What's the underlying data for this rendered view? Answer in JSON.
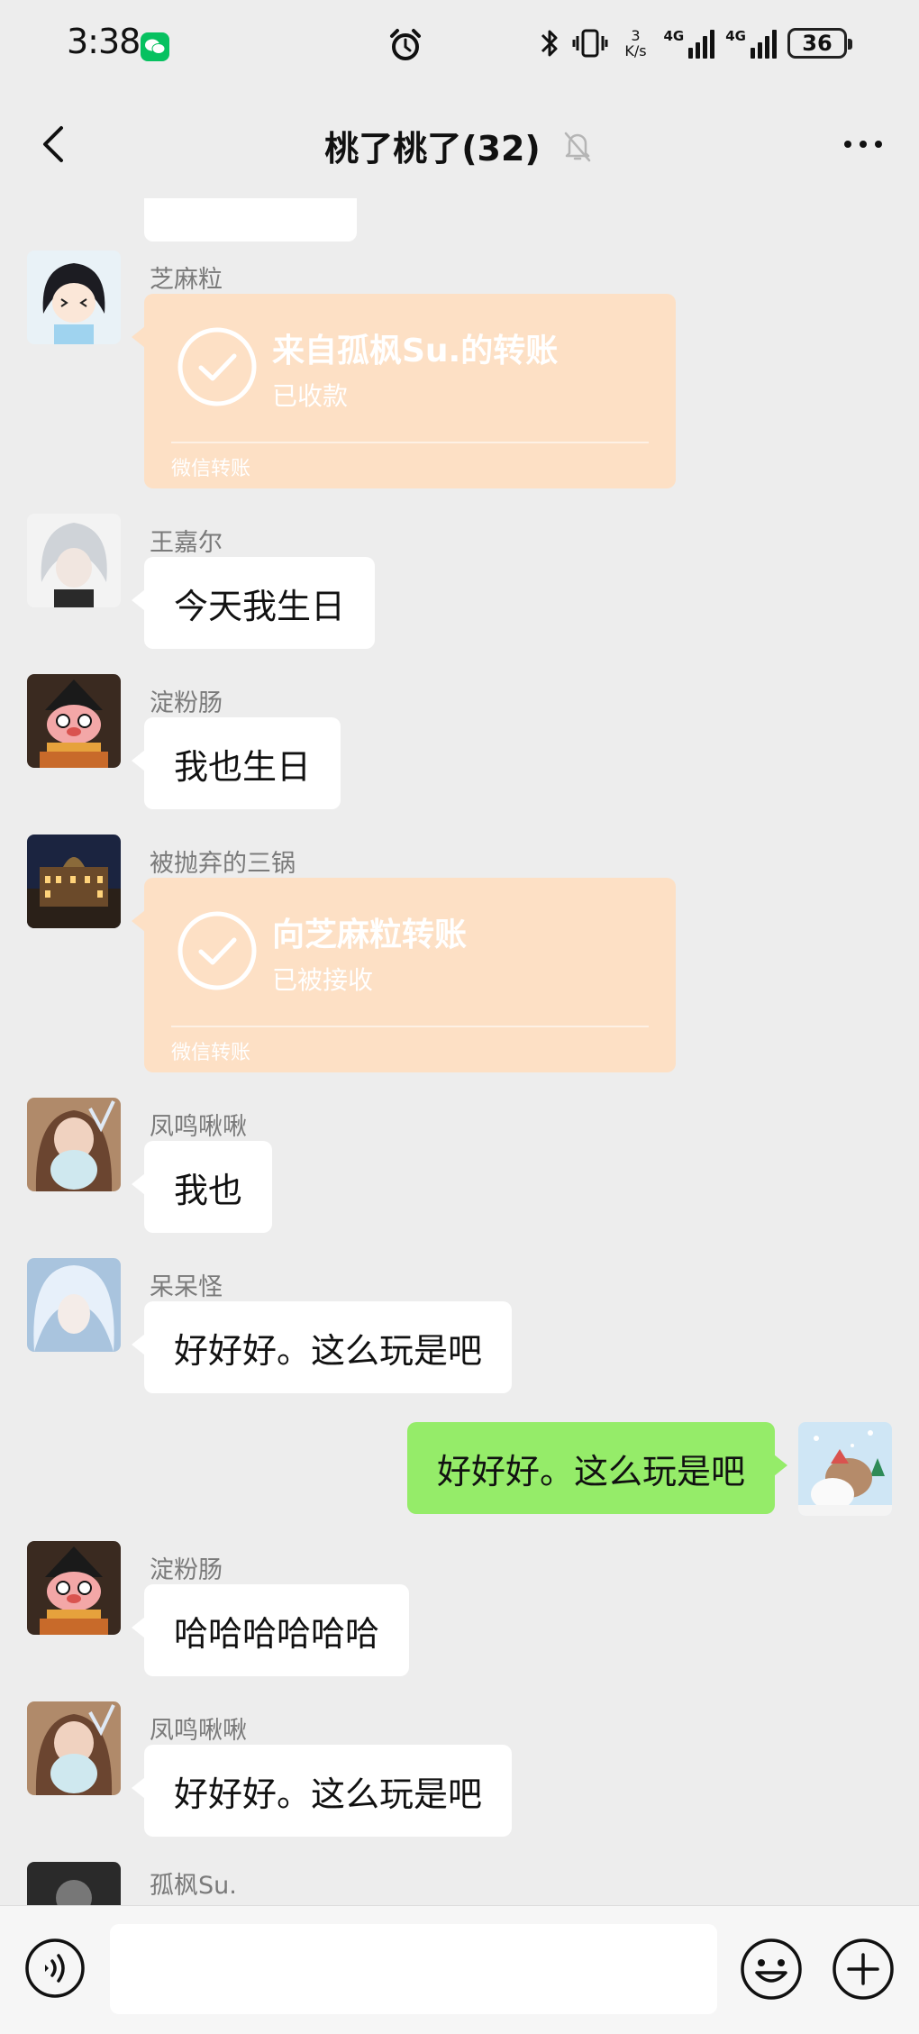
{
  "status_bar": {
    "time": "3:38",
    "speed_value": "3",
    "speed_unit": "K/s",
    "net1": "4G",
    "net2": "4G",
    "battery": "36"
  },
  "nav": {
    "title": "桃了桃了(32)"
  },
  "messages": [
    {
      "type": "transfer",
      "sender": "芝麻粒",
      "title": "来自孤枫Su.的转账",
      "status": "已收款",
      "footer": "微信转账",
      "avatar": "anime-girl-avatar"
    },
    {
      "type": "text",
      "sender": "王嘉尔",
      "text": "今天我生日",
      "avatar": "white-hair-anime-avatar"
    },
    {
      "type": "text",
      "sender": "淀粉肠",
      "text": "我也生日",
      "avatar": "pig-doll-avatar"
    },
    {
      "type": "transfer",
      "sender": "被抛弃的三锅",
      "title": "向芝麻粒转账",
      "status": "已被接收",
      "footer": "微信转账",
      "avatar": "night-building-avatar"
    },
    {
      "type": "text",
      "sender": "凤鸣啾啾",
      "text": "我也",
      "avatar": "girl-drink-avatar"
    },
    {
      "type": "text",
      "sender": "呆呆怪",
      "text": "好好好。这么玩是吧",
      "avatar": "ice-hair-avatar"
    },
    {
      "type": "text",
      "sender": "",
      "text": "好好好。这么玩是吧",
      "self": true,
      "avatar": "cartoon-bear-avatar"
    },
    {
      "type": "text",
      "sender": "淀粉肠",
      "text": "哈哈哈哈哈哈",
      "avatar": "pig-doll-avatar"
    },
    {
      "type": "text",
      "sender": "凤鸣啾啾",
      "text": "好好好。这么玩是吧",
      "avatar": "girl-drink-avatar"
    },
    {
      "type": "partial",
      "sender": "孤枫Su.",
      "avatar": "dark-avatar"
    }
  ],
  "colors": {
    "background": "#ededed",
    "self_bubble": "#95ec69",
    "transfer_card": "#fde0c5",
    "wechat_green": "#07c160"
  }
}
